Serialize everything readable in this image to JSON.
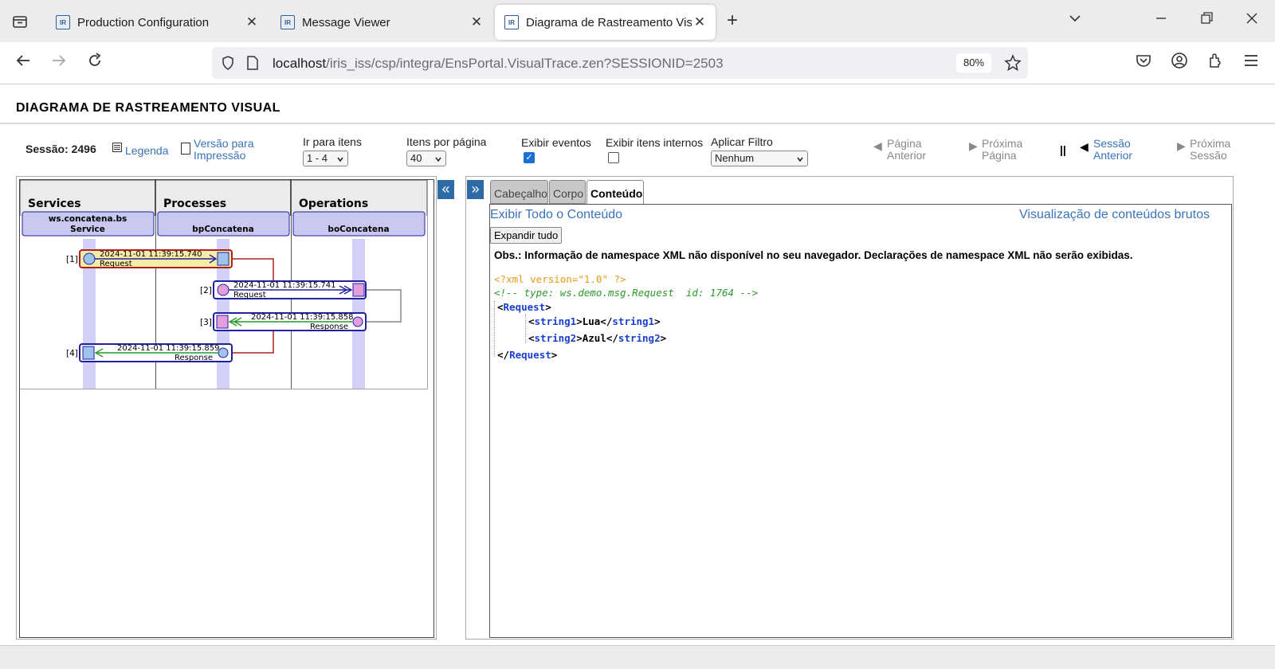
{
  "browser": {
    "tabs": [
      {
        "label": "Production Configuration",
        "favicon": "IR",
        "active": false
      },
      {
        "label": "Message Viewer",
        "favicon": "IR",
        "active": false
      },
      {
        "label": "Diagrama de Rastreamento Visual",
        "favicon": "IR",
        "active": true
      }
    ],
    "url_host": "localhost",
    "url_path": "/iris_iss/csp/integra/EnsPortal.VisualTrace.zen?SESSIONID=2503",
    "zoom": "80%"
  },
  "page": {
    "title": "DIAGRAMA DE RASTREAMENTO VISUAL"
  },
  "toolbar": {
    "session_label": "Sessão: 2496",
    "legend_link": "Legenda",
    "print_link_line1": "Versão para",
    "print_link_line2": "Impressão",
    "goto_label": "Ir para itens",
    "goto_value": "1 - 4",
    "per_page_label": "Itens por página",
    "per_page_value": "40",
    "show_events_label": "Exibir eventos",
    "show_events_checked": true,
    "show_internal_label": "Exibir itens internos",
    "show_internal_checked": false,
    "filter_label": "Aplicar Filtro",
    "filter_value": "Nenhum",
    "prev_page_line1": "Página",
    "prev_page_line2": "Anterior",
    "next_page_line1": "Próxima",
    "next_page_line2": "Página",
    "separator": "||",
    "prev_session_line1": "Sessão",
    "prev_session_line2": "Anterior",
    "next_session_line1": "Próxima",
    "next_session_line2": "Sessão"
  },
  "diagram": {
    "columns": [
      {
        "title": "Services",
        "host": [
          "ws.concatena.bs",
          "Service"
        ]
      },
      {
        "title": "Processes",
        "host": [
          "bpConcatena"
        ]
      },
      {
        "title": "Operations",
        "host": [
          "boConcatena"
        ]
      }
    ],
    "messages": [
      {
        "index": "[1]",
        "time": "2024-11-01 11:39:15.740",
        "type": "Request"
      },
      {
        "index": "[2]",
        "time": "2024-11-01 11:39:15.741",
        "type": "Request"
      },
      {
        "index": "[3]",
        "time": "2024-11-01 11:39:15.858",
        "type": "Response"
      },
      {
        "index": "[4]",
        "time": "2024-11-01 11:39:15.859",
        "type": "Response"
      }
    ],
    "collapse_glyph": "«",
    "expand_glyph": "»"
  },
  "detail": {
    "tabs": [
      "Cabeçalho",
      "Corpo",
      "Conteúdo"
    ],
    "active_tab": "Conteúdo",
    "show_all_link": "Exibir Todo o Conteúdo",
    "raw_link": "Visualização de conteúdos brutos",
    "expand_button": "Expandir tudo",
    "notice": "Obs.: Informação de namespace XML não disponível no seu navegador. Declarações de namespace XML não serão exibidas.",
    "xml_decl": "<?xml version=\"1.0\" ?>",
    "xml_comment": "<!-- type: ws.demo.msg.Request  id: 1764 -->",
    "root_tag": "Request",
    "fields": [
      {
        "tag": "string1",
        "value": "Lua"
      },
      {
        "tag": "string2",
        "value": "Azul"
      }
    ]
  },
  "colors": {
    "accent_blue": "#3a73b8",
    "lifeline": "#d0d0f8",
    "request_highlight": "#f5eca6",
    "request_border_red": "#b02020",
    "response_arrow_green": "#2a9a2a",
    "host_box": "#c8c8f0"
  }
}
